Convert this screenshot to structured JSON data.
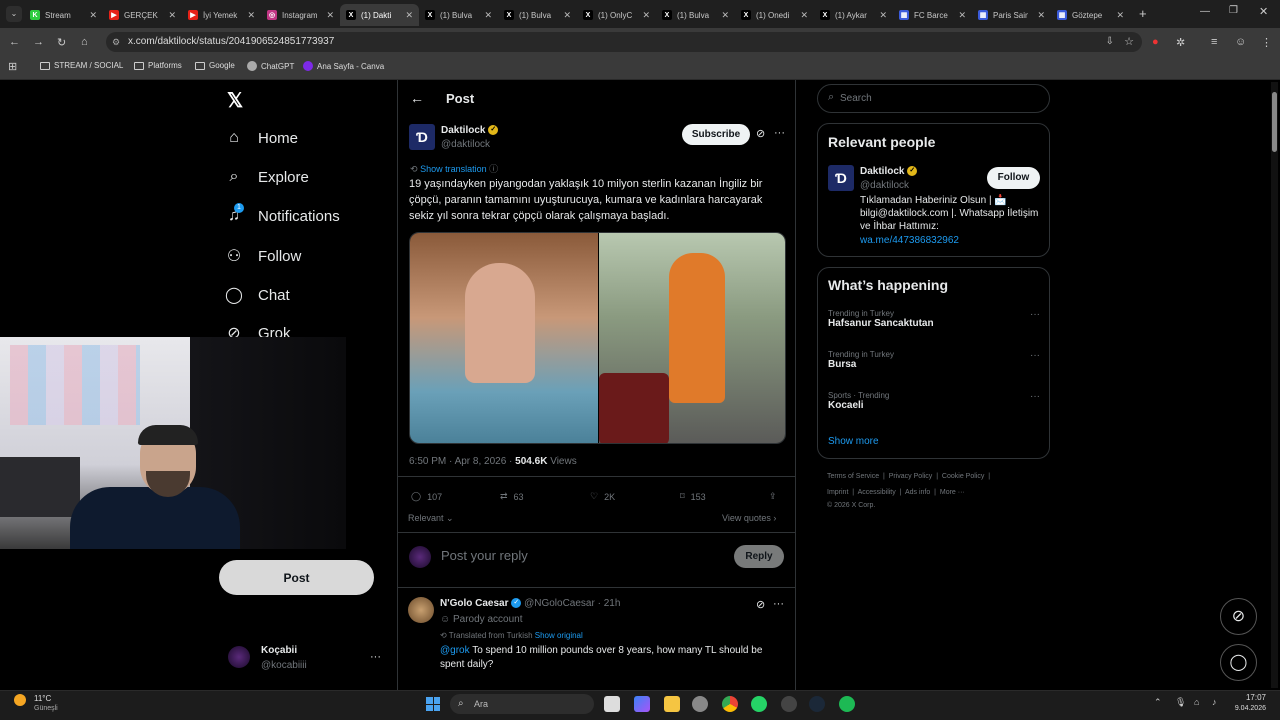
{
  "browser": {
    "tabs": [
      {
        "label": "Stream",
        "fav": "K",
        "color": "#2ecc40"
      },
      {
        "label": "GERÇEK",
        "fav": "▶",
        "color": "#e62117"
      },
      {
        "label": "İyi Yemek",
        "fav": "▶",
        "color": "#e62117"
      },
      {
        "label": "Instagram",
        "fav": "◎",
        "color": "#c13584"
      },
      {
        "label": "(1) Dakti",
        "fav": "X",
        "color": "#000000"
      },
      {
        "label": "(1) Bulva",
        "fav": "X",
        "color": "#000000"
      },
      {
        "label": "(1) Bulva",
        "fav": "X",
        "color": "#000000"
      },
      {
        "label": "(1) OnlyC",
        "fav": "X",
        "color": "#000000"
      },
      {
        "label": "(1) Bulva",
        "fav": "X",
        "color": "#000000"
      },
      {
        "label": "(1) Onedi",
        "fav": "X",
        "color": "#000000"
      },
      {
        "label": "(1) Aykar",
        "fav": "X",
        "color": "#000000"
      },
      {
        "label": "FC Barce",
        "fav": "▦",
        "color": "#3b5bdb"
      },
      {
        "label": "Paris Sain",
        "fav": "▦",
        "color": "#3b5bdb"
      },
      {
        "label": "Göztepe",
        "fav": "▦",
        "color": "#3b5bdb"
      }
    ],
    "url": "x.com/daktilock/status/2041906524851773937",
    "bookmarks": [
      "STREAM / SOCIAL",
      "Platforms",
      "Google",
      "ChatGPT",
      "Ana Sayfa - Canva"
    ]
  },
  "nav": {
    "items": [
      {
        "label": "Home",
        "icon": "⌂"
      },
      {
        "label": "Explore",
        "icon": "⌕"
      },
      {
        "label": "Notifications",
        "icon": "🔔"
      },
      {
        "label": "Follow",
        "icon": "👤"
      },
      {
        "label": "Chat",
        "icon": "◯"
      },
      {
        "label": "Grok",
        "icon": "⊘"
      }
    ],
    "post_label": "Post",
    "notification_badge": "1",
    "user": {
      "name": "Koçabii",
      "handle": "@kocabiiii"
    }
  },
  "post": {
    "header": "Post",
    "author": {
      "name": "Daktilock",
      "handle": "@daktilock"
    },
    "subscribe_label": "Subscribe",
    "show_translation": "Show translation",
    "text": "19 yaşındayken piyangodan yaklaşık 10 milyon sterlin kazanan İngiliz bir çöpçü, paranın tamamını uyuşturucuya, kumara ve kadınlara harcayarak sekiz yıl sonra tekrar çöpçü olarak çalışmaya başladı.",
    "time": "6:50 PM · Apr 8, 2026 ·",
    "views_count": "504.6K",
    "views_label": "Views",
    "stats": {
      "replies": "107",
      "reposts": "63",
      "likes": "2K",
      "bookmarks": "153"
    },
    "relevant_label": "Relevant",
    "view_quotes_label": "View quotes",
    "reply_placeholder": "Post your reply",
    "reply_button": "Reply"
  },
  "reply": {
    "name": "N'Golo Caesar",
    "handle": "@NGoloCaesar",
    "time": "· 21h",
    "parody": "Parody account",
    "translated_from": "Translated from Turkish",
    "show_original": "Show original",
    "mention": "@grok",
    "text": " To spend 10 million pounds over 8 years, how many TL should be spent daily?"
  },
  "search": {
    "placeholder": "Search"
  },
  "relevant_people": {
    "title": "Relevant people",
    "name": "Daktilock",
    "handle": "@daktilock",
    "follow_label": "Follow",
    "bio": "Tıklamadan Haberiniz Olsun | 📩 bilgi@daktilock.com |. Whatsapp İletişim ve İhbar Hattımız:",
    "link": "wa.me/447386832962"
  },
  "happening": {
    "title": "What’s happening",
    "trends": [
      {
        "category": "Trending in Turkey",
        "name": "Hafsanur Sancaktutan"
      },
      {
        "category": "Trending in Turkey",
        "name": "Bursa"
      },
      {
        "category": "Sports · Trending",
        "name": "Kocaeli"
      }
    ],
    "show_more": "Show more"
  },
  "footer": {
    "links1": [
      "Terms of Service",
      "Privacy Policy",
      "Cookie Policy"
    ],
    "links2": [
      "Imprint",
      "Accessibility",
      "Ads info",
      "More ···"
    ],
    "copyright": "© 2026 X Corp."
  },
  "taskbar": {
    "weather_temp": "11°C",
    "weather_desc": "Güneşli",
    "search_placeholder": "Ara",
    "time": "17:07",
    "date": "9.04.2026"
  },
  "colors": {
    "accent": "#1d9bf0",
    "verified": "#e2b719",
    "background": "#000000"
  }
}
